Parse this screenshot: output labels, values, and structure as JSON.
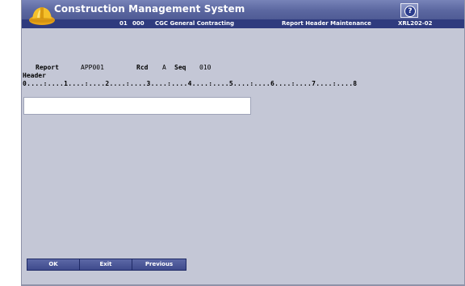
{
  "app": {
    "title": "Construction Management System"
  },
  "infobar": {
    "company_code": "01",
    "division_code": "000",
    "company_name": "CGC General Contracting",
    "screen_name": "Report Header Maintenance",
    "screen_id": "XRL202-02"
  },
  "help": {
    "label": "?"
  },
  "form": {
    "report_label": "Report",
    "report_value": "APP001",
    "rcd_label": "Rcd",
    "rcd_value": "A",
    "seq_label": "Seq",
    "seq_value": "010",
    "header_label": "Header",
    "ruler": "0....:....1....:....2....:....3....:....4....:....5....:....6....:....7....:....8",
    "header_value": ""
  },
  "buttons": {
    "ok": "OK",
    "exit": "Exit",
    "previous": "Previous"
  },
  "colors": {
    "background": "#c4c7d6",
    "titlebar": "#5b67a0",
    "infobar": "#2f3b7e",
    "button": "#4a5698"
  }
}
